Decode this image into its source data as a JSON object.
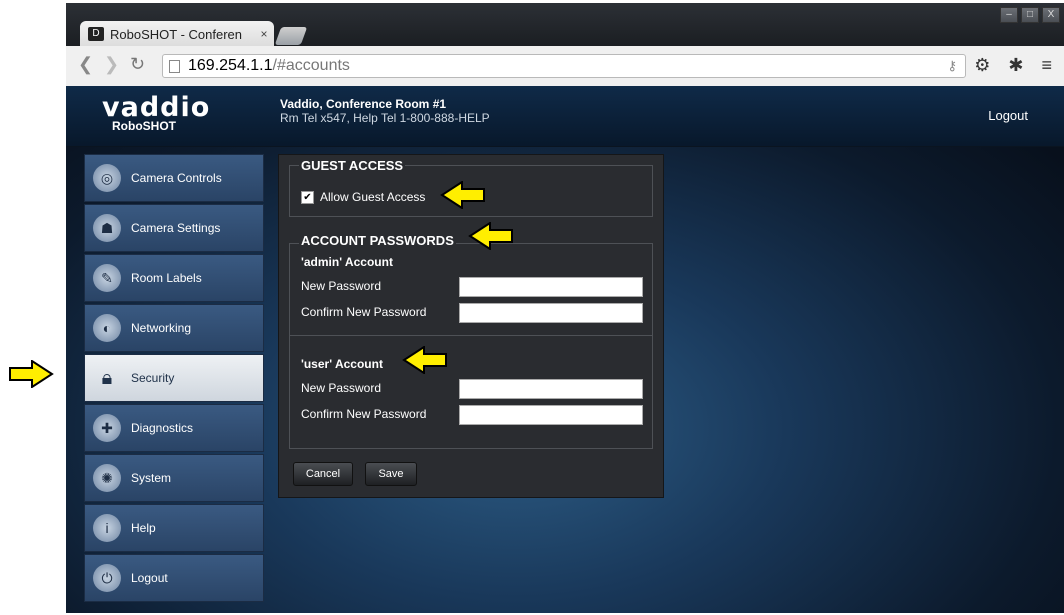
{
  "browser": {
    "tab_title": "RoboSHOT - Conferen",
    "tab_close": "×",
    "favicon": "D",
    "url_host": "169.254.1.1",
    "url_path": "/#accounts",
    "window_controls": [
      "–",
      "□",
      "X"
    ]
  },
  "header": {
    "logo": "vaddio",
    "product": "RoboSHOT",
    "room_line1": "Vaddio, Conference Room #1",
    "room_line2": "Rm Tel x547, Help Tel 1-800-888-HELP",
    "logout": "Logout"
  },
  "sidebar": {
    "items": [
      {
        "label": "Camera Controls",
        "icon": "camera-controls-icon",
        "active": false
      },
      {
        "label": "Camera Settings",
        "icon": "camera-settings-icon",
        "active": false
      },
      {
        "label": "Room Labels",
        "icon": "room-labels-icon",
        "active": false
      },
      {
        "label": "Networking",
        "icon": "networking-icon",
        "active": false
      },
      {
        "label": "Security",
        "icon": "lock-icon",
        "active": true
      },
      {
        "label": "Diagnostics",
        "icon": "diagnostics-icon",
        "active": false
      },
      {
        "label": "System",
        "icon": "system-icon",
        "active": false
      },
      {
        "label": "Help",
        "icon": "help-icon",
        "active": false
      },
      {
        "label": "Logout",
        "icon": "power-icon",
        "active": false
      }
    ]
  },
  "guest": {
    "title": "GUEST ACCESS",
    "checkbox_label": "Allow Guest Access",
    "checked": true
  },
  "accounts": {
    "title": "ACCOUNT PASSWORDS",
    "admin_label": "'admin' Account",
    "user_label": "'user' Account",
    "new_password": "New Password",
    "confirm_password": "Confirm New Password"
  },
  "buttons": {
    "cancel": "Cancel",
    "save": "Save"
  },
  "colors": {
    "arrow": "#ffee00",
    "panel": "#2a2c30",
    "accent": "#3a5a82"
  }
}
